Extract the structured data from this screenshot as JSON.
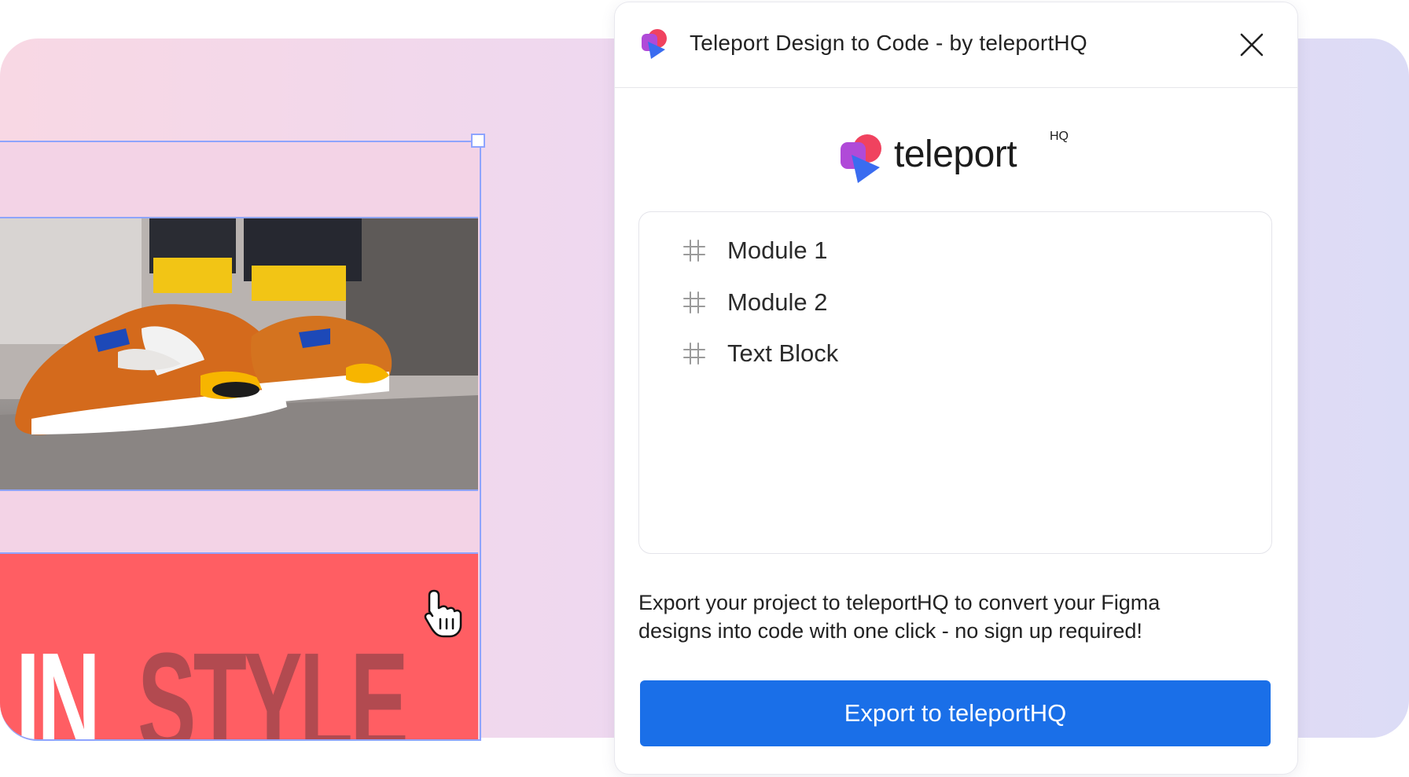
{
  "panel": {
    "title": "Teleport Design to Code - by teleportHQ",
    "brand_word": "teleport",
    "brand_suffix": "HQ",
    "modules": [
      {
        "label": "Module 1",
        "icon": "hash-icon"
      },
      {
        "label": "Module 2",
        "icon": "hash-icon"
      },
      {
        "label": "Text Block",
        "icon": "hash-icon"
      }
    ],
    "description_line1": "Export your project to teleportHQ to convert your Figma",
    "description_line2": "designs into code with one click - no sign up required!",
    "export_label": "Export to teleportHQ",
    "accent_color": "#1a6fe8"
  },
  "canvas": {
    "headline_word1": "IN",
    "headline_word2": "STYLE",
    "band_color": "#ff5e63",
    "selection_color": "#8ea4ff"
  }
}
